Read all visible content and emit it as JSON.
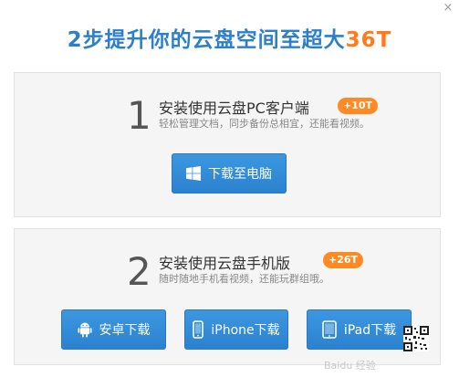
{
  "dialog": {
    "close_label": "×",
    "title_main": "2步提升你的云盘空间至超大",
    "title_highlight": "36T"
  },
  "step1": {
    "number": "1",
    "title": "安装使用云盘PC客户端",
    "badge": "+10T",
    "desc": "轻松管理文档，同步备份总相宜，还能看视频。",
    "button_label": "下载至电脑",
    "button_icon": "windows-icon"
  },
  "step2": {
    "number": "2",
    "title": "安装使用云盘手机版",
    "badge": "+26T",
    "desc": "随时随地手机看视频，还能玩群组哦。",
    "buttons": [
      {
        "label": "安卓下载",
        "icon": "android-icon"
      },
      {
        "label": "iPhone下载",
        "icon": "iphone-icon"
      },
      {
        "label": "iPad下载",
        "icon": "ipad-icon"
      }
    ]
  },
  "watermark": "Baidu 经验",
  "colors": {
    "title_blue": "#2d7fc7",
    "accent_orange": "#ff7a1a",
    "button_blue": "#2b82cf",
    "panel_bg": "#f5f5f5"
  }
}
